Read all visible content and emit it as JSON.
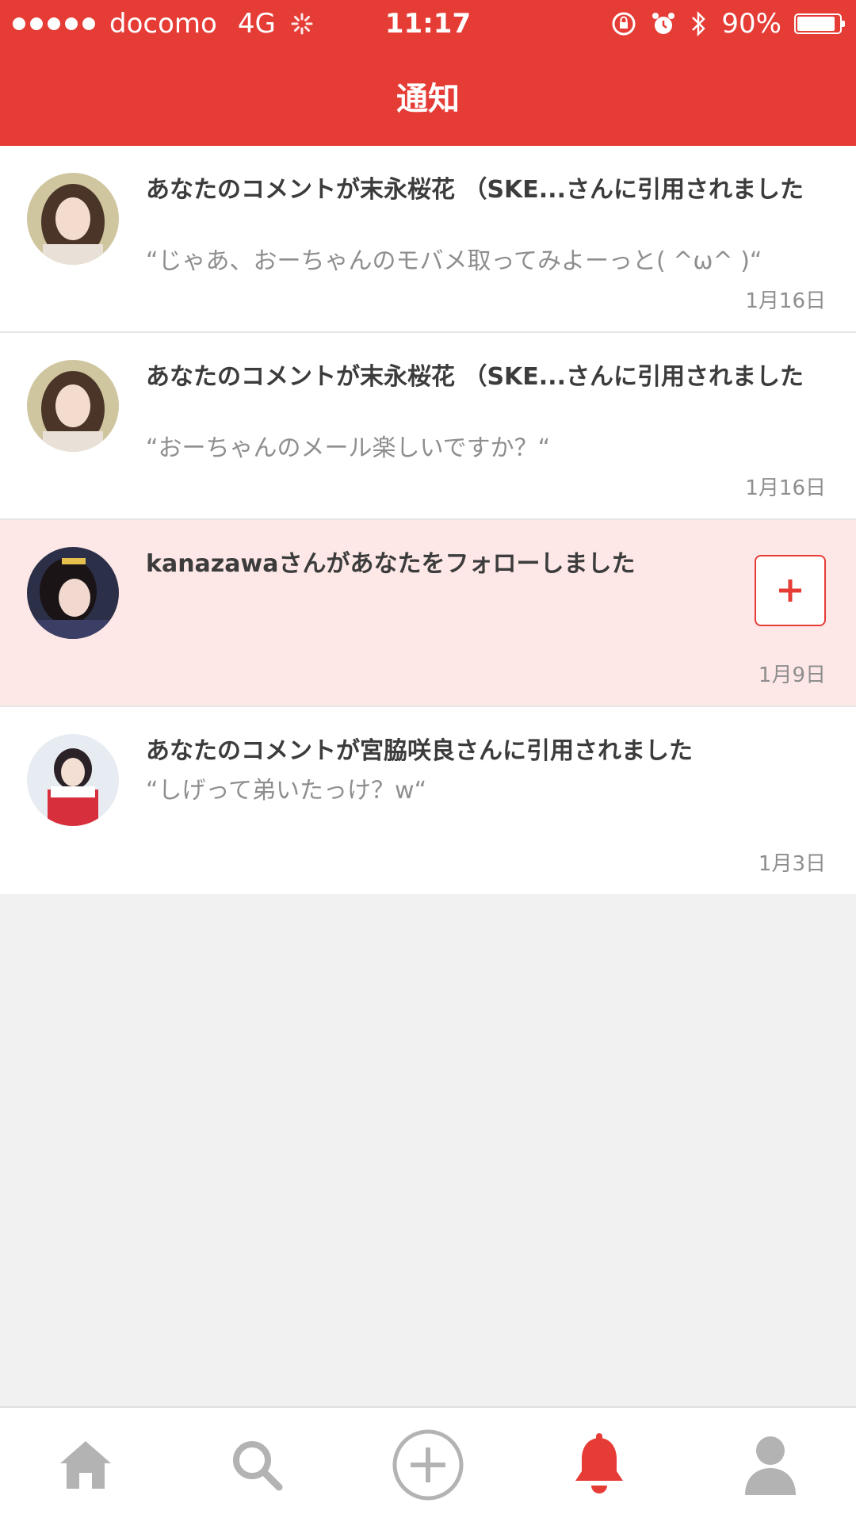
{
  "status_bar": {
    "carrier": "docomo",
    "network": "4G",
    "time": "11:17",
    "battery_text": "90%",
    "battery_level": 0.9
  },
  "header": {
    "title": "通知",
    "background": "#e63c36"
  },
  "notifications": [
    {
      "title": "あなたのコメントが末永桜花 （SKE...さんに引用されました",
      "quote": "“じゃあ、おーちゃんのモバメ取ってみよーっと( ^ω^ )“",
      "date": "1月16日"
    },
    {
      "title": "あなたのコメントが末永桜花 （SKE...さんに引用されました",
      "quote": "“おーちゃんのメール楽しいですか？“",
      "date": "1月16日"
    },
    {
      "title": "kanazawaさんがあなたをフォローしました",
      "date": "1月9日",
      "follow_icon": "plus-icon"
    },
    {
      "title": "あなたのコメントが宮脇咲良さんに引用されました",
      "quote": "“しげって弟いたっけ？w“",
      "date": "1月3日"
    }
  ],
  "tabbar": {
    "tabs": [
      "home-icon",
      "search-icon",
      "add-icon",
      "bell-icon",
      "profile-icon"
    ],
    "active": "bell-icon",
    "active_color": "#e63c36",
    "inactive_color": "#b3b3b3"
  }
}
